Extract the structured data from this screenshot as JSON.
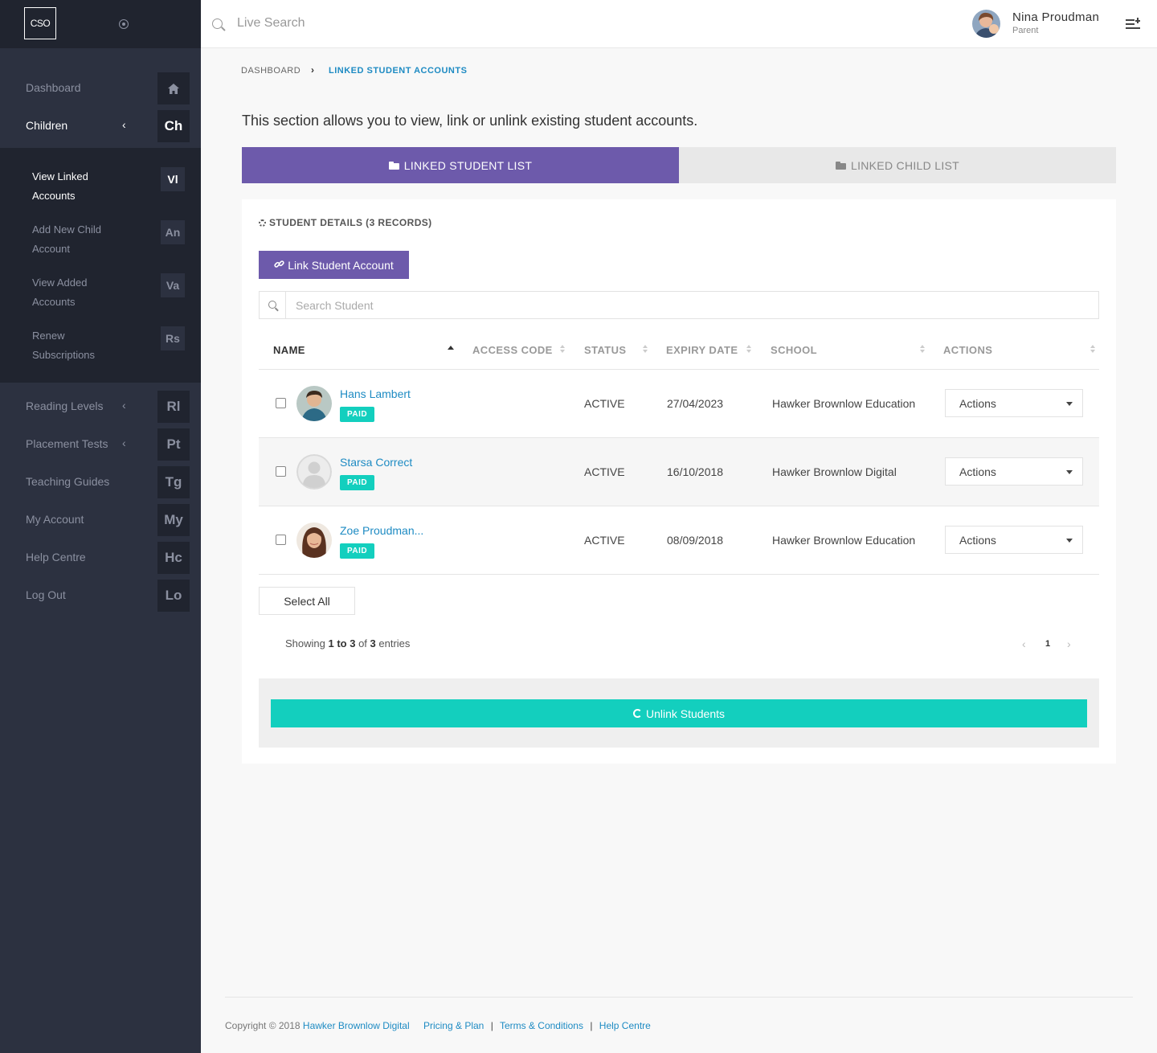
{
  "sidebar": {
    "logo": "CSO",
    "items": [
      {
        "label": "Dashboard",
        "abbr": "⌂",
        "active": false,
        "chevron": false
      },
      {
        "label": "Children",
        "abbr": "Ch",
        "active": true,
        "chevron": true
      },
      {
        "label": "Reading Levels",
        "abbr": "Rl",
        "active": false,
        "chevron": true
      },
      {
        "label": "Placement Tests",
        "abbr": "Pt",
        "active": false,
        "chevron": true
      },
      {
        "label": "Teaching Guides",
        "abbr": "Tg",
        "active": false,
        "chevron": false
      },
      {
        "label": "My Account",
        "abbr": "My",
        "active": false,
        "chevron": false
      },
      {
        "label": "Help Centre",
        "abbr": "Hc",
        "active": false,
        "chevron": false
      },
      {
        "label": "Log Out",
        "abbr": "Lo",
        "active": false,
        "chevron": false
      }
    ],
    "chevron": "‹",
    "sub_items": [
      {
        "label": "View Linked Accounts",
        "abbr": "Vl",
        "active": true
      },
      {
        "label": "Add New Child Account",
        "abbr": "An",
        "active": false
      },
      {
        "label": "View Added Accounts",
        "abbr": "Va",
        "active": false
      },
      {
        "label": "Renew Subscriptions",
        "abbr": "Rs",
        "active": false
      }
    ]
  },
  "header": {
    "search_placeholder": "Live Search",
    "user_name": "Nina Proudman",
    "user_role": "Parent"
  },
  "breadcrumb": {
    "root": "DASHBOARD",
    "separator": "›",
    "current": "LINKED STUDENT ACCOUNTS"
  },
  "intro": "This section allows you to view, link or unlink existing student accounts.",
  "tabs": [
    {
      "label": "LINKED STUDENT LIST",
      "active": true
    },
    {
      "label": "LINKED CHILD LIST",
      "active": false
    }
  ],
  "panel": {
    "title": "STUDENT DETAILS (3 RECORDS)",
    "link_button": "Link Student Account",
    "search_placeholder": "Search Student",
    "columns": [
      "NAME",
      "ACCESS CODE",
      "STATUS",
      "EXPIRY DATE",
      "SCHOOL",
      "ACTIONS"
    ],
    "rows": [
      {
        "name": "Hans Lambert",
        "badge": "PAID",
        "access_code": "",
        "status": "ACTIVE",
        "expiry": "27/04/2023",
        "school": "Hawker Brownlow Education",
        "action": "Actions",
        "avatar": "boy"
      },
      {
        "name": "Starsa Correct",
        "badge": "PAID",
        "access_code": "",
        "status": "ACTIVE",
        "expiry": "16/10/2018",
        "school": "Hawker Brownlow Digital",
        "action": "Actions",
        "avatar": "placeholder"
      },
      {
        "name": "Zoe Proudman...",
        "badge": "PAID",
        "access_code": "",
        "status": "ACTIVE",
        "expiry": "08/09/2018",
        "school": "Hawker Brownlow Education",
        "action": "Actions",
        "avatar": "girl"
      }
    ],
    "select_all": "Select All",
    "showing": {
      "prefix": "Showing ",
      "range": "1 to 3",
      "of": " of ",
      "total": "3",
      "suffix": " entries"
    },
    "pagination": {
      "prev": "‹",
      "page": "1",
      "next": "›"
    },
    "unlink_button": "Unlink Students"
  },
  "footer": {
    "copyright": "Copyright © 2018 ",
    "company": "Hawker Brownlow Digital",
    "links": [
      "Pricing & Plan",
      "Terms & Conditions",
      "Help Centre"
    ],
    "separator": "|"
  },
  "colors": {
    "sidebar_bg": "#2c3140",
    "sidebar_dark": "#20242f",
    "primary": "#6d5aab",
    "teal": "#13cfbe",
    "link": "#1e8bc3"
  }
}
